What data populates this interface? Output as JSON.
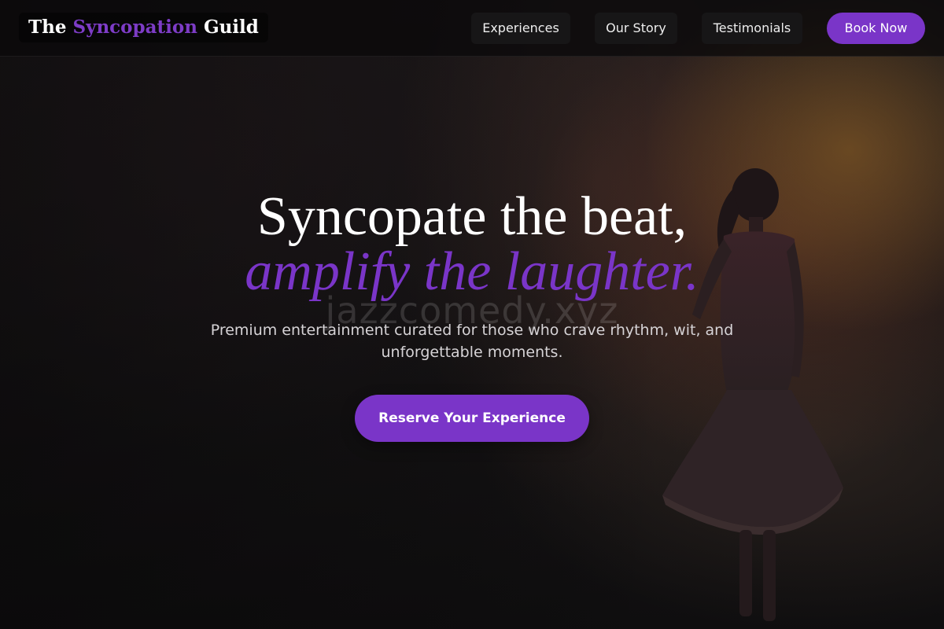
{
  "colors": {
    "accent": "#7a35c8",
    "nav_button_bg": "#171617",
    "text_light": "#d6d3d6",
    "background": "#0d0c0d"
  },
  "navbar": {
    "logo": {
      "part1": "The ",
      "part2": "Syncopation",
      "part3": " Guild"
    },
    "links": [
      {
        "label": "Experiences"
      },
      {
        "label": "Our Story"
      },
      {
        "label": "Testimonials"
      }
    ],
    "book_button": "Book Now"
  },
  "hero": {
    "headline_line1": "Syncopate the beat,",
    "headline_line2": "amplify the laughter.",
    "watermark": "jazzcomedy.xyz",
    "subtext": "Premium entertainment curated for those who crave rhythm, wit, and unforgettable moments.",
    "cta_button": "Reserve Your Experience"
  }
}
